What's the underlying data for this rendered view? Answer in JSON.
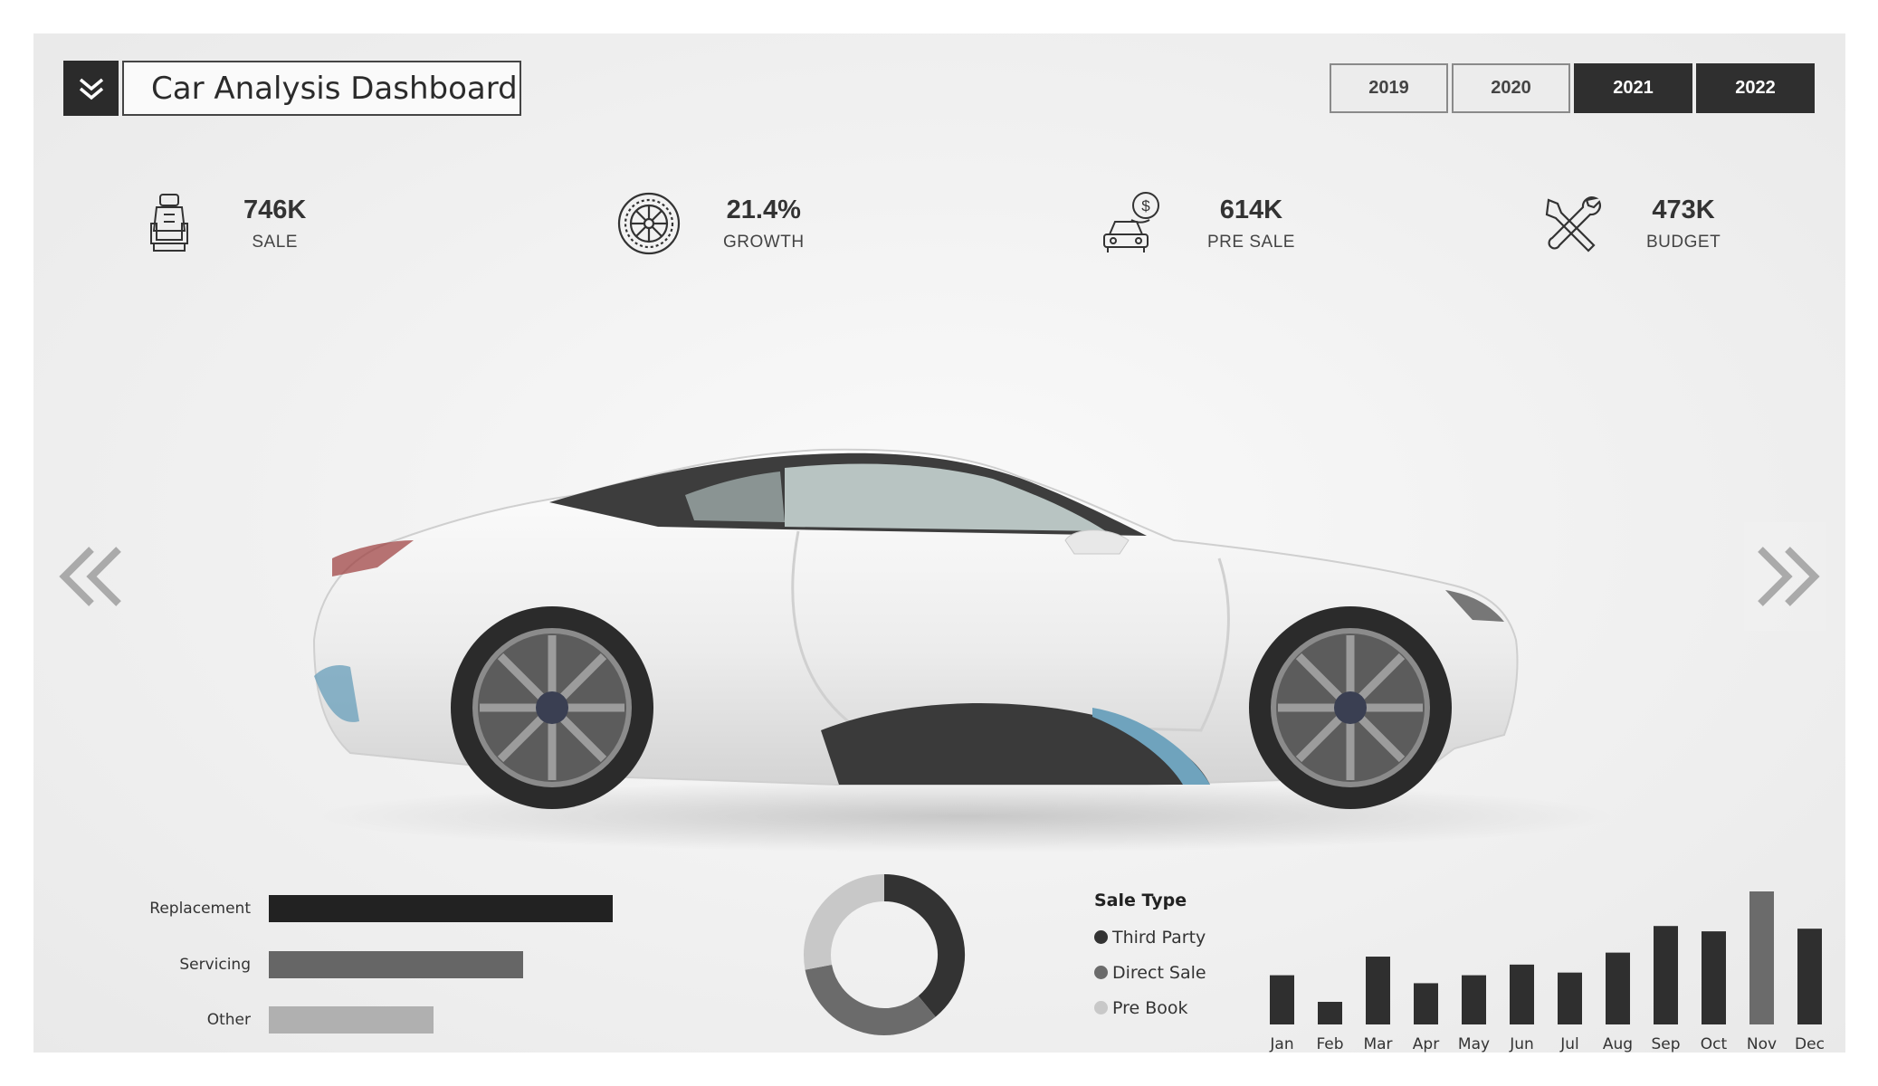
{
  "header": {
    "title": "Car Analysis Dashboard",
    "menu_icon": "double-chevron-down-icon",
    "years": [
      {
        "label": "2019",
        "active": false
      },
      {
        "label": "2020",
        "active": false
      },
      {
        "label": "2021",
        "active": true
      },
      {
        "label": "2022",
        "active": true
      }
    ]
  },
  "kpis": [
    {
      "value": "746K",
      "label": "SALE",
      "icon": "car-seat-icon"
    },
    {
      "value": "21.4%",
      "label": "GROWTH",
      "icon": "tire-icon"
    },
    {
      "value": "614K",
      "label": "PRE SALE",
      "icon": "car-dollar-icon"
    },
    {
      "value": "473K",
      "label": "BUDGET",
      "icon": "wrench-screwdriver-icon"
    }
  ],
  "nav": {
    "prev_icon": "double-chevron-left-icon",
    "next_icon": "double-chevron-right-icon"
  },
  "colors": {
    "dark": "#2f2f2f",
    "mid": "#6b6b6b",
    "light": "#b3b3b3",
    "lighter": "#c8c8c8"
  },
  "chart_data": [
    {
      "type": "bar",
      "orientation": "horizontal",
      "categories": [
        "Replacement",
        "Servicing",
        "Other"
      ],
      "values": [
        100,
        74,
        48
      ],
      "colors": [
        "#222222",
        "#666666",
        "#b0b0b0"
      ]
    },
    {
      "type": "pie",
      "donut": true,
      "legend_title": "Sale Type",
      "labels": [
        "Third Party",
        "Direct Sale",
        "Pre Book"
      ],
      "values": [
        39,
        33,
        28
      ],
      "colors": [
        "#333333",
        "#6b6b6b",
        "#c8c8c8"
      ]
    },
    {
      "type": "bar",
      "categories": [
        "Jan",
        "Feb",
        "Mar",
        "Apr",
        "May",
        "Jun",
        "Jul",
        "Aug",
        "Sep",
        "Oct",
        "Nov",
        "Dec"
      ],
      "values": [
        37,
        17,
        51,
        31,
        37,
        45,
        39,
        54,
        74,
        70,
        100,
        72
      ],
      "highlight_index": 10,
      "colors": [
        "#2f2f2f",
        "#6b6b6b"
      ]
    }
  ]
}
